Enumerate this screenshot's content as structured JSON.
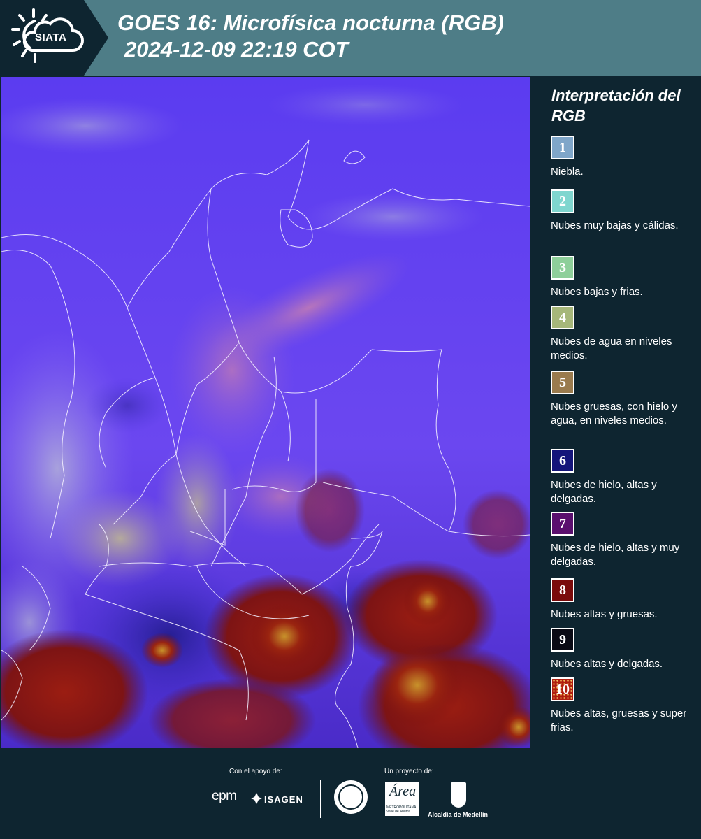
{
  "header": {
    "logo_text": "SIATA",
    "title_line1": "GOES 16: Microfísica nocturna (RGB)",
    "title_line2": "2024-12-09 22:19 COT"
  },
  "legend": {
    "title": "Interpretación del RGB",
    "items": [
      {
        "number": "1",
        "label": "Niebla.",
        "color": "#7fa6c9"
      },
      {
        "number": "2",
        "label": "Nubes muy bajas y cálidas.",
        "color": "#7fd6cf"
      },
      {
        "number": "3",
        "label": "Nubes bajas y frias.",
        "color": "#8ecf9a"
      },
      {
        "number": "4",
        "label": "Nubes de agua en niveles medios.",
        "color": "#a6b77a"
      },
      {
        "number": "5",
        "label": "Nubes gruesas, con hielo y agua, en niveles medios.",
        "color": "#9a7b4e"
      },
      {
        "number": "6",
        "label": "Nubes de hielo, altas y delgadas.",
        "color": "#14157a"
      },
      {
        "number": "7",
        "label": "Nubes de hielo, altas y muy delgadas.",
        "color": "#5a0f6e"
      },
      {
        "number": "8",
        "label": "Nubes altas y gruesas.",
        "color": "#7a0b0b"
      },
      {
        "number": "9",
        "label": "Nubes altas y delgadas.",
        "color": "#0a0a14"
      },
      {
        "number": "10",
        "label": "Nubes altas, gruesas y super frias.",
        "color": "#b01e10"
      }
    ]
  },
  "footer": {
    "support_label": "Con el apoyo de:",
    "project_label": "Un proyecto de:",
    "sponsor1": "epm",
    "sponsor2": "ISAGEN",
    "partner_area": "Área",
    "partner_area_sub": "METROPOLITANA Valle de Aburrá",
    "partner_alcaldia": "Alcaldía de Medellín"
  },
  "colors": {
    "background": "#0e2530",
    "header_band": "#4e7d87",
    "map_base": "#6b3cf2"
  }
}
